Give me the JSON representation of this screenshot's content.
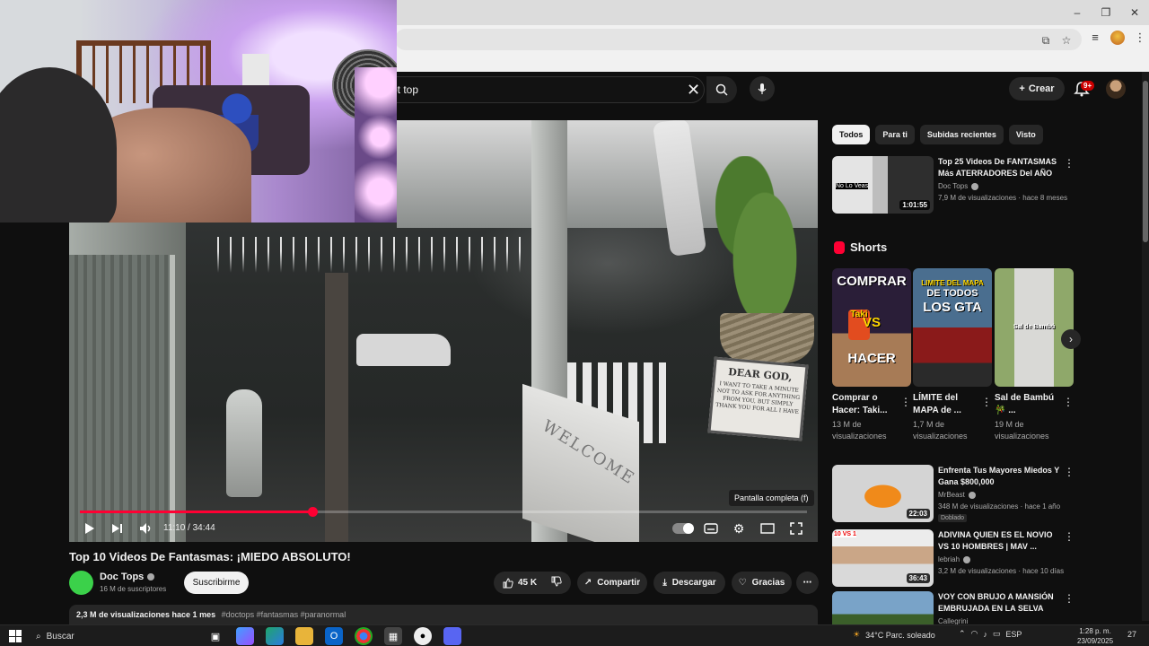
{
  "browser": {
    "window_controls": {
      "minimize": "–",
      "restore": "❐",
      "close": "✕"
    }
  },
  "header": {
    "search_query": "ot top",
    "create_label": "Crear",
    "notifications_badge": "9+"
  },
  "player": {
    "time_display": "11:10 / 34:44",
    "progress_fraction": 0.32,
    "tooltip": "Pantalla completa (f)",
    "sign_title": "DEAR GOD,",
    "sign_text": "I WANT TO TAKE A MINUTE NOT TO ASK FOR ANYTHING FROM YOU, BUT SIMPLY THANK YOU FOR ALL I HAVE",
    "welcome_text": "WELCOME"
  },
  "video": {
    "title": "Top 10 Videos De Fantasmas: ¡MIEDO ABSOLUTO!",
    "channel_name": "Doc Tops",
    "subscribers": "16 M de suscriptores",
    "subscribe_label": "Suscribirme",
    "likes": "45 K",
    "share_label": "Compartir",
    "download_label": "Descargar",
    "thanks_label": "Gracias",
    "views_date": "2,3 M de visualizaciones  hace 1 mes",
    "tags": "#doctops #fantasmas #paranormal"
  },
  "filters": [
    "Todos",
    "Para ti",
    "Subidas recientes",
    "Visto"
  ],
  "recommendations_top": {
    "title": "Top 25 Videos De FANTASMAS Más ATERRADORES Del AÑO",
    "channel": "Doc Tops",
    "meta": "7,9 M de visualizaciones · hace 8 meses",
    "duration": "1:01:55",
    "thumb_text": "No Lo Veas"
  },
  "shorts": {
    "heading": "Shorts",
    "items": [
      {
        "title": "Comprar o Hacer: Taki...",
        "views": "13 M de visualizaciones",
        "overlay_top": "COMPRAR",
        "overlay_mid": "VS",
        "overlay_bottom": "HACER",
        "overlay_brand": "Taki"
      },
      {
        "title": "LÍMITE del MAPA de ...",
        "views": "1,7 M de visualizaciones",
        "overlay_top": "LIMITE DEL MAPA",
        "overlay_mid": "DE TODOS",
        "overlay_bottom": "LOS GTA"
      },
      {
        "title": "Sal de Bambú 🎋 ...",
        "views": "19 M de visualizaciones",
        "overlay_top": "Sal de Bambú"
      }
    ]
  },
  "recommendations": [
    {
      "title": "Enfrenta Tus Mayores Miedos Y Gana $800,000",
      "channel": "MrBeast",
      "meta": "348 M de visualizaciones · hace 1 año",
      "badge": "Doblado",
      "duration": "22:03"
    },
    {
      "title": "ADIVINA QUIEN ES EL NOVIO VS 10 HOMBRES | MAV ...",
      "channel": "lebriah",
      "meta": "3,2 M de visualizaciones · hace 10 días",
      "duration": "36:43",
      "thumb_text": "10 VS 1"
    },
    {
      "title": "VOY CON BRUJO A MANSIÓN EMBRUJADA EN LA SELVA",
      "channel": "Callegrini"
    }
  ],
  "taskbar": {
    "search_label": "Buscar",
    "weather": "34°C  Parc. soleado",
    "language": "ESP",
    "time": "1:28 p. m.",
    "date": "23/09/2025",
    "notification_count": "27"
  },
  "colors": {
    "accent_red": "#ff0033",
    "background": "#0f0f0f",
    "chip_bg": "#272727"
  }
}
